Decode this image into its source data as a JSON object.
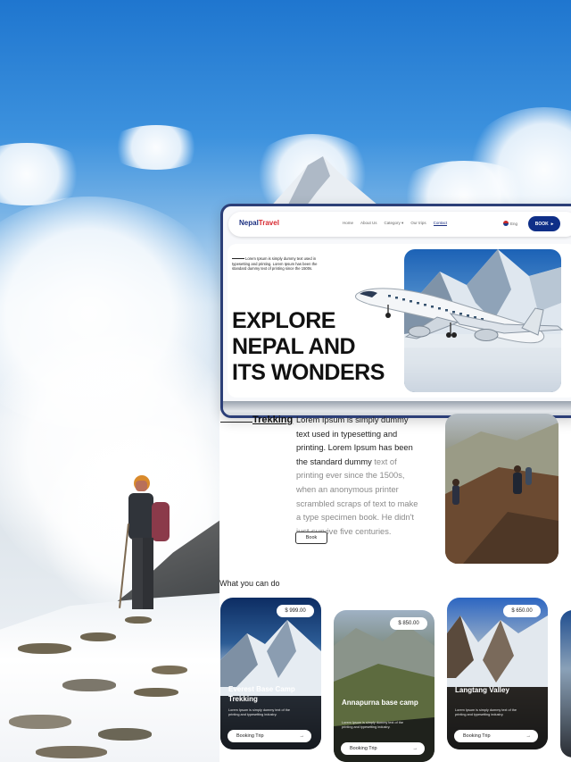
{
  "header": {
    "logo_part1": "Nepal",
    "logo_part2": "Travel",
    "nav": [
      "Home",
      "About Us",
      "Category ▾",
      "Our trips",
      "Contact"
    ],
    "language": "Eng",
    "book_label": "BOOK"
  },
  "hero": {
    "description": "Lorem Ipsum is simply dummy text used in typesetting and printing. Lorem Ipsum has been the standard dummy text of printing since the 1500s.",
    "title_line1": "EXPLORE",
    "title_line2": "NEPAL AND",
    "title_line3": "ITS WONDERS"
  },
  "trekking": {
    "label": "Trekking",
    "text_dark": "Lorem Ipsum is simply dummy text used in typesetting and printing. Lorem Ipsum has been the standard dummy",
    "text_muted": " text of printing ever since the 1500s, when an anonymous printer scrambled scraps of text to make a type specimen book. He didn't just survive five centuries.",
    "button": "Book"
  },
  "section_title": "What you can do",
  "trips": [
    {
      "title": "Everest Base Camp Trekking",
      "price": "$ 999.00",
      "desc": "Lorem Ipsum is simply dummy text of the printing and typesetting industry.",
      "button": "Booking Trip"
    },
    {
      "title": "Annapurna base camp",
      "price": "$ 850.00",
      "desc": "Lorem Ipsum is simply dummy text of the printing and typesetting industry.",
      "button": "Booking Trip"
    },
    {
      "title": "Langtang Valley",
      "price": "$ 650.00",
      "desc": "Lorem Ipsum is simply dummy text of the printing and typesetting industry.",
      "button": "Booking Trip"
    }
  ],
  "icons": {
    "book_arrow": "arrow-right-icon",
    "card_arrow": "arrow-right-icon",
    "flag": "us-flag-icon"
  },
  "colors": {
    "brand_blue": "#0f2f88",
    "brand_red": "#d7282f"
  }
}
